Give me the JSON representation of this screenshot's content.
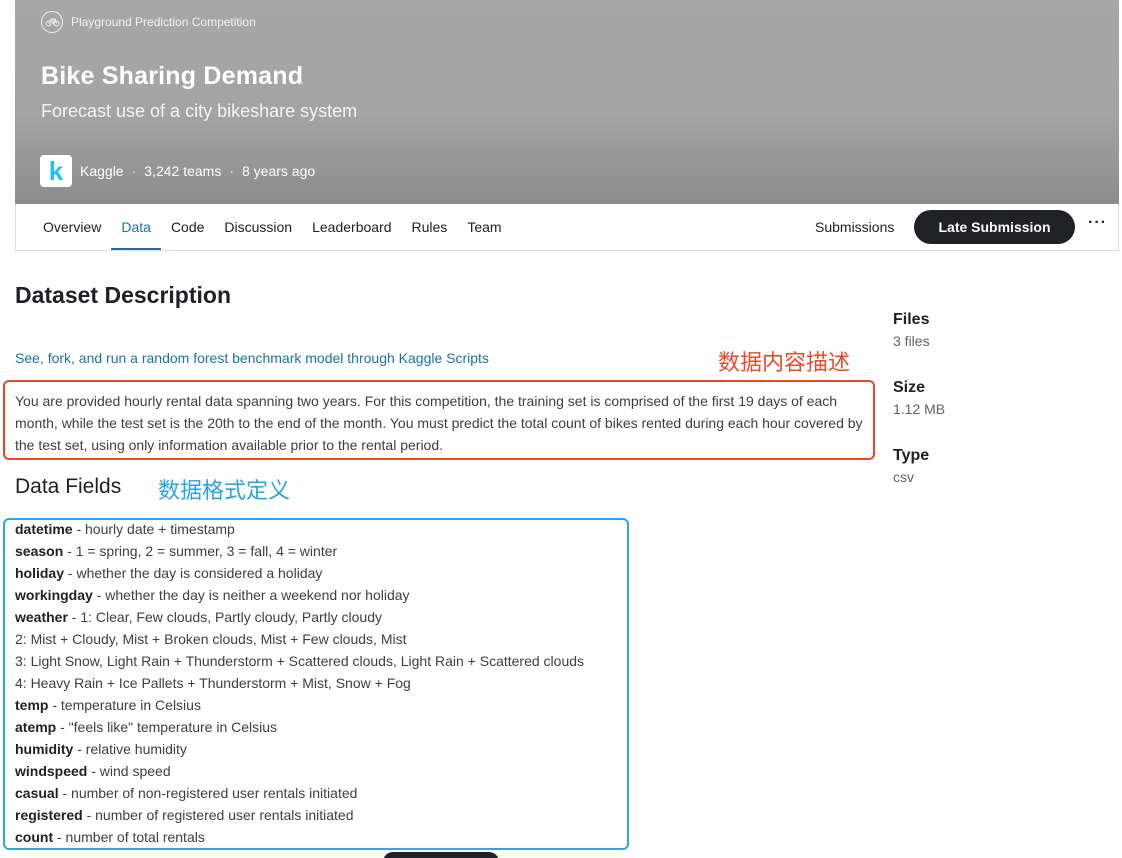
{
  "header": {
    "competition_type": "Playground Prediction Competition",
    "title": "Bike Sharing Demand",
    "subtitle": "Forecast use of a city bikeshare system",
    "host": "Kaggle",
    "teams": "3,242 teams",
    "age": "8 years ago",
    "host_logo_letter": "k"
  },
  "tabs": [
    {
      "label": "Overview"
    },
    {
      "label": "Data"
    },
    {
      "label": "Code"
    },
    {
      "label": "Discussion"
    },
    {
      "label": "Leaderboard"
    },
    {
      "label": "Rules"
    },
    {
      "label": "Team"
    }
  ],
  "active_tab": "Data",
  "actions": {
    "submissions_label": "Submissions",
    "late_submission_label": "Late Submission",
    "more_label": "···"
  },
  "main": {
    "dataset_title": "Dataset Description",
    "script_link": "See, fork, and run a random forest benchmark model through Kaggle Scripts",
    "annotation_description": "数据内容描述",
    "description": "You are provided hourly rental data spanning two years. For this competition, the training set is comprised of the first 19 days of each month, while the test set is the 20th to the end of the month. You must predict the total count of bikes rented during each hour covered by the test set, using only information available prior to the rental period.",
    "fields_title": "Data Fields",
    "annotation_fields": "数据格式定义",
    "fields": [
      {
        "name": "datetime",
        "desc": " - hourly date + timestamp"
      },
      {
        "name": "season",
        "desc": " -  1 = spring, 2 = summer, 3 = fall, 4 = winter"
      },
      {
        "name": "holiday",
        "desc": " - whether the day is considered a holiday"
      },
      {
        "name": "workingday",
        "desc": " - whether the day is neither a weekend nor holiday"
      },
      {
        "name": "weather",
        "desc": " - 1: Clear, Few clouds, Partly cloudy, Partly cloudy"
      },
      {
        "name": "",
        "desc": "2: Mist + Cloudy, Mist + Broken clouds, Mist + Few clouds, Mist"
      },
      {
        "name": "",
        "desc": "3: Light Snow, Light Rain + Thunderstorm + Scattered clouds, Light Rain + Scattered clouds"
      },
      {
        "name": "",
        "desc": "4: Heavy Rain + Ice Pallets + Thunderstorm + Mist, Snow + Fog"
      },
      {
        "name": "temp",
        "desc": " - temperature in Celsius"
      },
      {
        "name": "atemp",
        "desc": " - \"feels like\" temperature in Celsius"
      },
      {
        "name": "humidity",
        "desc": " - relative humidity"
      },
      {
        "name": "windspeed",
        "desc": " - wind speed"
      },
      {
        "name": "casual",
        "desc": " - number of non-registered user rentals initiated"
      },
      {
        "name": "registered",
        "desc": " - number of registered user rentals initiated"
      },
      {
        "name": "count",
        "desc": " - number of total rentals"
      }
    ]
  },
  "sidebar": {
    "files_label": "Files",
    "files_value": "3 files",
    "size_label": "Size",
    "size_value": "1.12 MB",
    "type_label": "Type",
    "type_value": "csv"
  },
  "colors": {
    "accent": "#1a73a8",
    "annotation_red": "#e8452b",
    "annotation_blue": "#2ba7ea",
    "kaggle_blue": "#20beff"
  }
}
